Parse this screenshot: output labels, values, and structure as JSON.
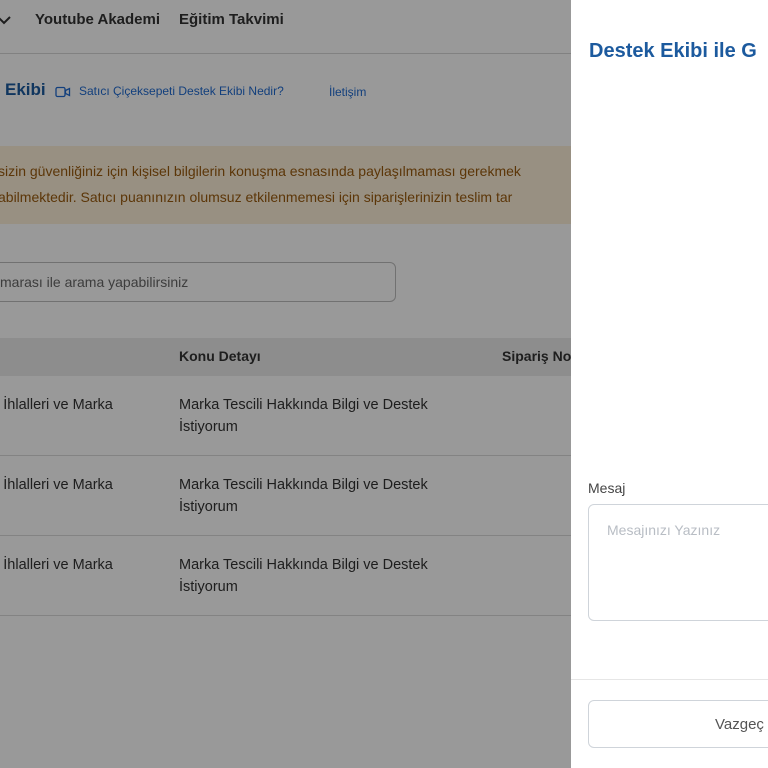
{
  "nav": {
    "items": [
      "Youtube Akademi",
      "Eğitim Takvimi"
    ]
  },
  "breadcrumb": {
    "title": "Ekibi",
    "link1": "Satıcı Çiçeksepeti Destek Ekibi Nedir?",
    "link2": "İletişim"
  },
  "warning": {
    "line1": "sizin güvenliğiniz için kişisel bilgilerin konuşma esnasında paylaşılmaması gerekmek",
    "line2": "abilmektedir. Satıcı puanınızın olumsuz etkilenmemesi için siparişlerinizin teslim tar"
  },
  "search": {
    "placeholder": "marası ile arama yapabilirsiniz"
  },
  "table": {
    "headers": [
      "Konu Detayı",
      "Sipariş No"
    ],
    "rows": [
      {
        "topic": "k İhlalleri ve Marka",
        "detail": "Marka Tescili Hakkında Bilgi ve Destek İstiyorum"
      },
      {
        "topic": "k İhlalleri ve Marka",
        "detail": "Marka Tescili Hakkında Bilgi ve Destek İstiyorum"
      },
      {
        "topic": "k İhlalleri ve Marka",
        "detail": "Marka Tescili Hakkında Bilgi ve Destek İstiyorum"
      }
    ]
  },
  "drawer": {
    "title": "Destek Ekibi ile G",
    "message_label": "Mesaj",
    "message_placeholder": "Mesajınızı Yazınız",
    "message_value": "",
    "cancel_label": "Vazgeç"
  },
  "icons": {
    "nav_chevron": "chevron-down-icon",
    "breadcrumb_video": "video-icon"
  },
  "colors": {
    "brand_blue": "#1c5a9e",
    "link_blue": "#1f6ad0",
    "warning_bg": "#fdf1d9",
    "warning_text": "#9a5a0e"
  }
}
